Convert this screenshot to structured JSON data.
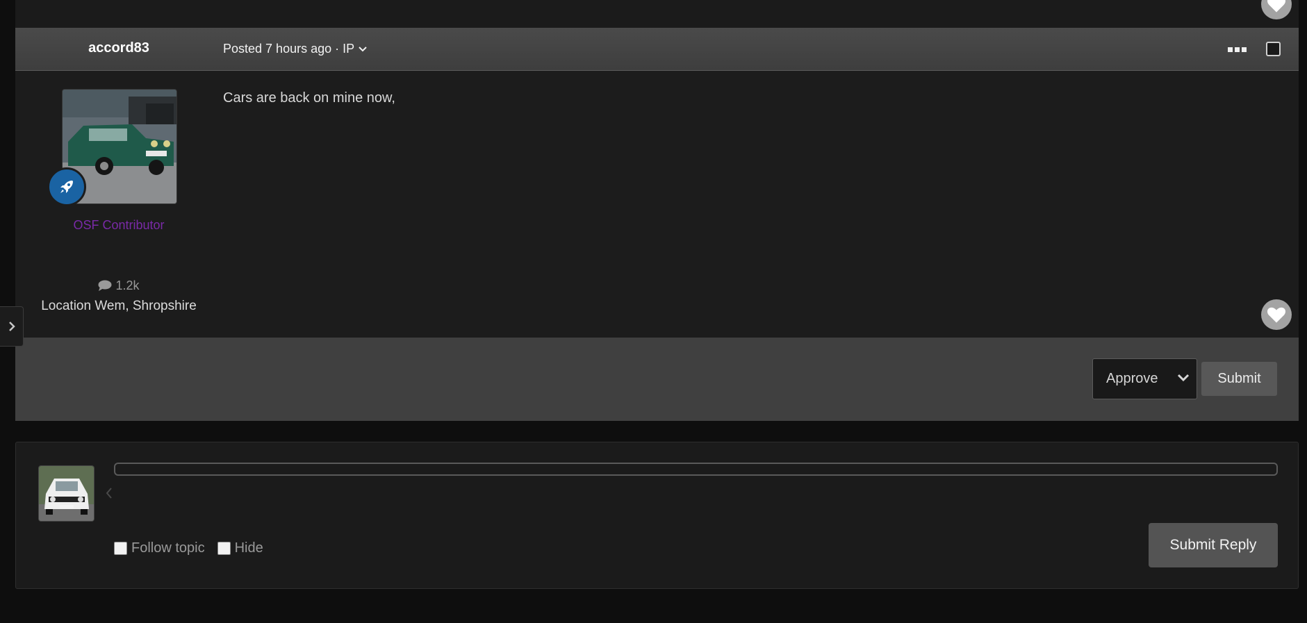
{
  "post": {
    "author": "accord83",
    "meta_text": "Posted 7 hours ago · IP",
    "content": "Cars are back on mine now,",
    "rank": "OSF Contributor",
    "post_count": "1.2k",
    "location": "Location Wem, Shropshire",
    "badge_icon": "rocket-icon",
    "rank_color": "#7a2aa8",
    "badge_color": "#1a63a3"
  },
  "moderation": {
    "action_selected": "Approve",
    "submit_label": "Submit"
  },
  "reply": {
    "follow_label": "Follow topic",
    "hide_label": "Hide",
    "submit_label": "Submit Reply"
  }
}
